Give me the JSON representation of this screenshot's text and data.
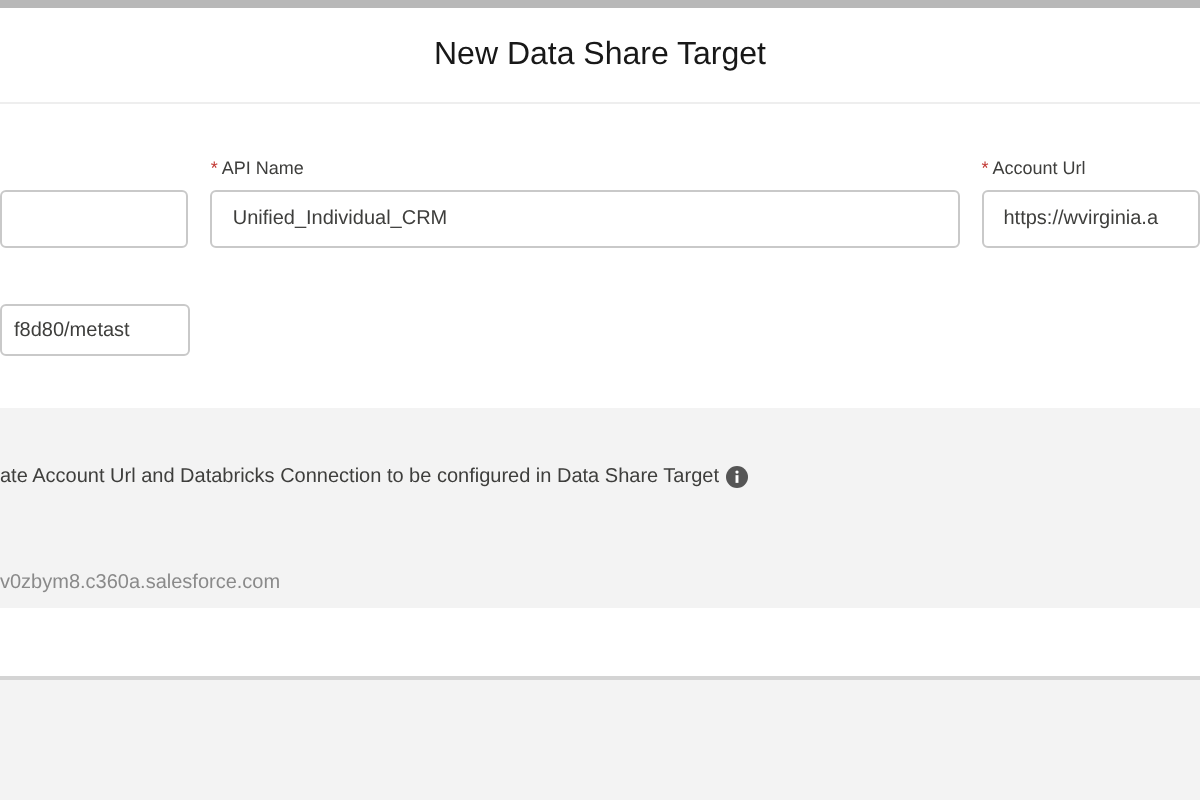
{
  "dialog": {
    "title": "New Data Share Target"
  },
  "fields": [
    {
      "kind": "input"
    },
    {
      "kind": "input",
      "required_mark": "*",
      "label": "API Name",
      "value": "Unified_Individual_CRM"
    },
    {
      "kind": "input",
      "required_mark": "*",
      "label": "Account Url",
      "value": "https://wvirginia.a"
    },
    {
      "kind": "input",
      "value": "f8d80/metast"
    }
  ],
  "info_section": {
    "text": "ate Account Url and Databricks Connection to be configured in Data Share Target",
    "value": "v0zbym8.c360a.salesforce.com"
  }
}
